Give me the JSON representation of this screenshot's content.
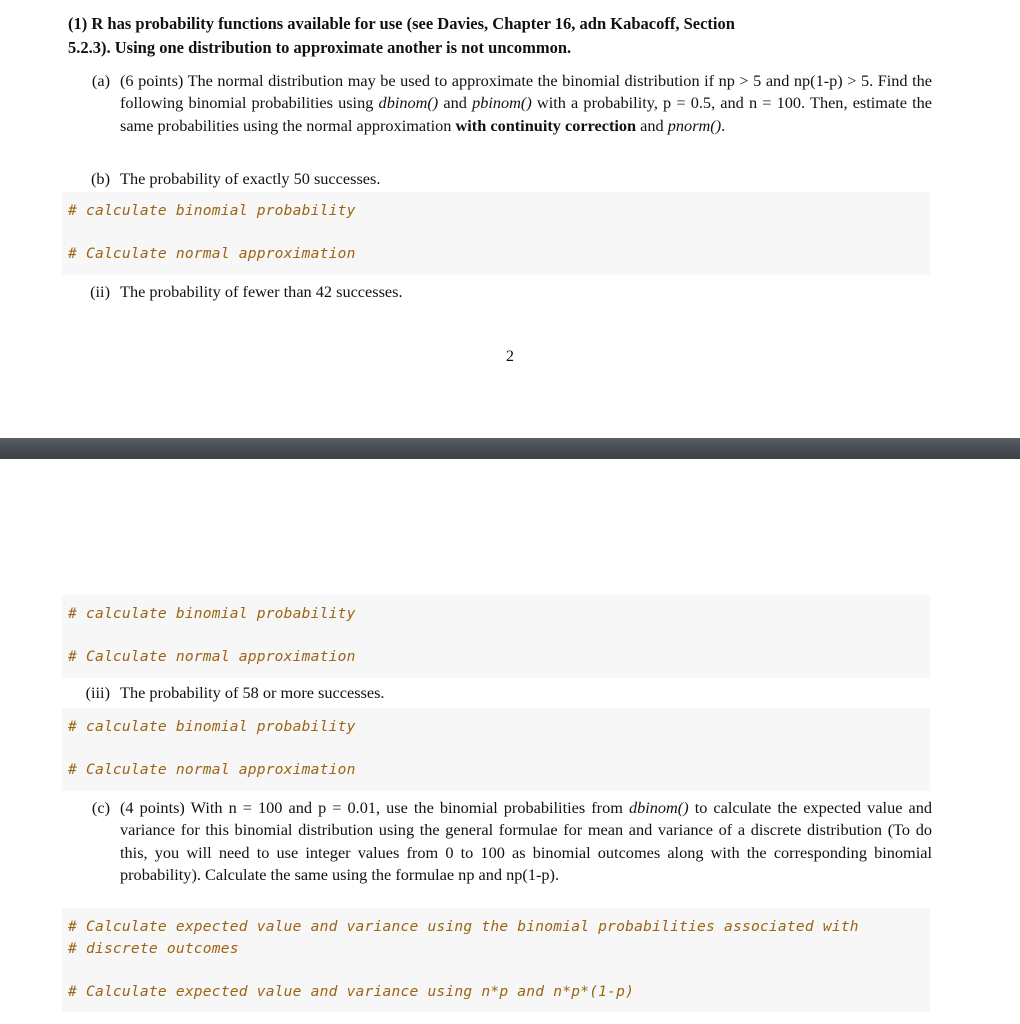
{
  "document": {
    "type": "pdf-assignment",
    "colors": {
      "page_background": "#ffffff",
      "text": "#111111",
      "code_background": "#f7f7f7",
      "code_comment": "#9c6413",
      "page_divider": "#4a4e54"
    }
  },
  "page_one": {
    "question": {
      "number": "(1)",
      "text_line1": "R has probability functions available for use (see Davies, Chapter 16, adn Kabacoff, Section",
      "text_line2": "5.2.3).  Using one distribution to approximate another is not uncommon."
    },
    "item_a": {
      "label": "(a)",
      "points": "(6 points)",
      "seg1": " The normal distribution may be used to approximate the binomial distribution if np > 5 and np(1-p) > 5. Find the following binomial probabilities using ",
      "fn1": "dbinom()",
      "seg2": " and ",
      "fn2": "pbinom()",
      "seg3": " with a probability, p = 0.5, and n = 100. Then, estimate the same probabilities using the normal approximation ",
      "bold1": "with continuity correction",
      "seg4": " and ",
      "fn3": "pnorm()",
      "seg5": "."
    },
    "item_b": {
      "label": "(b)",
      "text": "The probability of exactly 50 successes."
    },
    "code_b": {
      "lines": [
        "# calculate binomial probability",
        "",
        "# Calculate normal approximation"
      ]
    },
    "item_ii": {
      "label": "(ii)",
      "text": "The probability of fewer than 42 successes."
    },
    "folio": "2"
  },
  "page_two": {
    "code_ii": {
      "lines": [
        "# calculate binomial probability",
        "",
        "# Calculate normal approximation"
      ]
    },
    "item_iii": {
      "label": "(iii)",
      "text": "The probability of 58 or more successes."
    },
    "code_iii": {
      "lines": [
        "# calculate binomial probability",
        "",
        "# Calculate normal approximation"
      ]
    },
    "item_c": {
      "label": "(c)",
      "points": "(4 points)",
      "seg1": " With n = 100 and p = 0.01, use the binomial probabilities from ",
      "fn1": "dbinom()",
      "seg2": " to calculate the expected value and variance for this binomial distribution using the general formulae for mean and variance of a discrete distribution (To do this, you will need to use integer values from 0 to 100 as binomial outcomes along with the corresponding binomial probability).  Calculate the same using the formulae np and np(1-p)."
    },
    "code_c": {
      "lines": [
        "# Calculate expected value and variance using the binomial probabilities associated with",
        "# discrete outcomes",
        "",
        "# Calculate expected value and variance using n*p and n*p*(1-p)"
      ]
    }
  }
}
